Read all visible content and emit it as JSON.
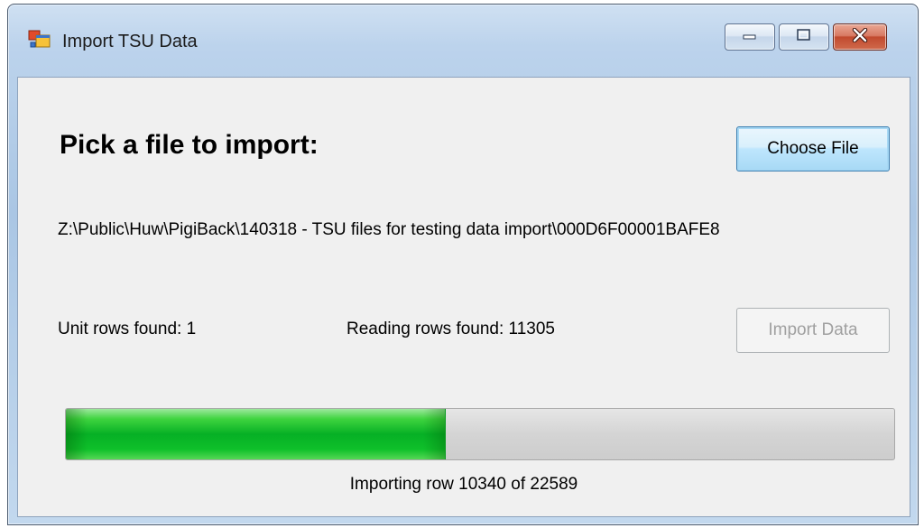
{
  "window": {
    "title": "Import TSU Data",
    "icons": {
      "app": "windows-form-icon",
      "minimize": "minimize-icon",
      "maximize": "maximize-icon",
      "close": "close-icon"
    }
  },
  "form": {
    "heading": "Pick a file to import:",
    "choose_file_label": "Choose File",
    "file_path": "Z:\\Public\\Huw\\PigiBack\\140318 - TSU files for testing data import\\000D6F00001BAFE8",
    "unit_rows": "Unit rows found: 1",
    "reading_rows": "Reading rows found: 11305",
    "import_label": "Import Data",
    "import_enabled": false
  },
  "progress": {
    "current": 10340,
    "total": 22589,
    "fraction": 0.4577,
    "status": "Importing row 10340 of 22589",
    "fill_color": "#06b025"
  }
}
